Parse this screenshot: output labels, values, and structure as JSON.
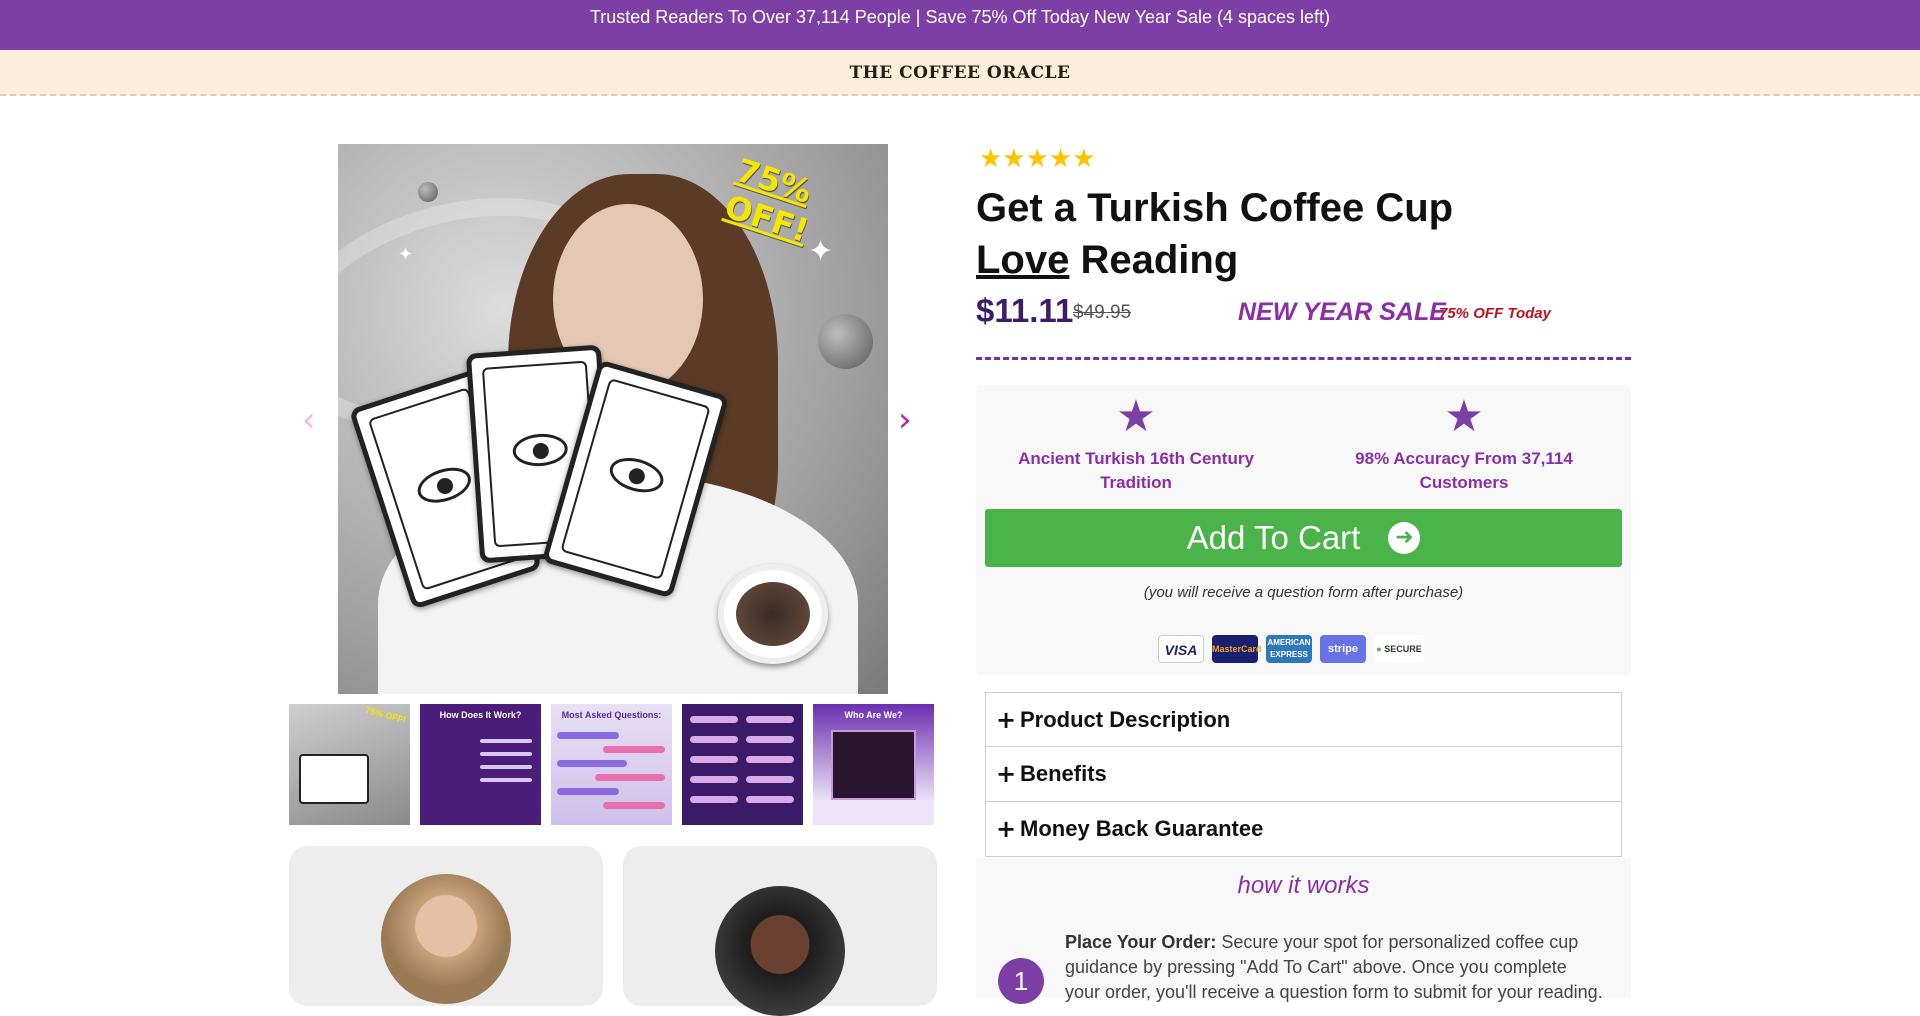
{
  "announcement": "Trusted Readers To Over 37,114 People | Save 75% Off Today New Year Sale (4 spaces left)",
  "brand": "THE COFFEE ORACLE",
  "gallery": {
    "badge": "75% OFF!",
    "prev_icon": "‹",
    "next_icon": "›",
    "thumbnails": [
      {
        "title": "",
        "badge": "75% OFF!"
      },
      {
        "title": "How Does It Work?"
      },
      {
        "title": "Most Asked Questions:"
      },
      {
        "title": ""
      },
      {
        "title": "Who Are We?"
      }
    ]
  },
  "product": {
    "rating_stars": "★★★★★",
    "title_line1": "Get a Turkish Coffee Cup",
    "title_love": "Love",
    "title_rest": " Reading",
    "price": "$11.11",
    "old_price": "$49.95",
    "sale_label": "NEW YEAR SALE",
    "sale_sub": "75% OFF Today"
  },
  "features": [
    {
      "icon": "star-icon",
      "text": "Ancient Turkish 16th Century Tradition"
    },
    {
      "icon": "star-icon",
      "text": "98% Accuracy From 37,114 Customers"
    }
  ],
  "cart": {
    "label": "Add To Cart",
    "arrow": "➜",
    "note": "(you will receive a question form after purchase)"
  },
  "payments": [
    "VISA",
    "MasterCard",
    "AMERICAN EXPRESS",
    "stripe",
    "SECURE"
  ],
  "accordion": [
    {
      "label": "Product Description"
    },
    {
      "label": "Benefits"
    },
    {
      "label": "Money Back Guarantee"
    }
  ],
  "how": {
    "title": "how it works",
    "step_number": "1",
    "step_title": "Place Your Order:",
    "step_body": " Secure your spot for personalized coffee cup guidance by pressing \"Add To Cart\" above. Once you complete your order, you'll receive a question form to submit for your reading."
  },
  "colors": {
    "announcement_bg": "#7d3fa5",
    "brand_bg": "#fbefdb",
    "accent_purple": "#8a2fa8",
    "price_color": "#3a1d6b",
    "sale_red": "#c01020",
    "cart_green": "#4ab44a",
    "star_gold": "#ffc400"
  }
}
